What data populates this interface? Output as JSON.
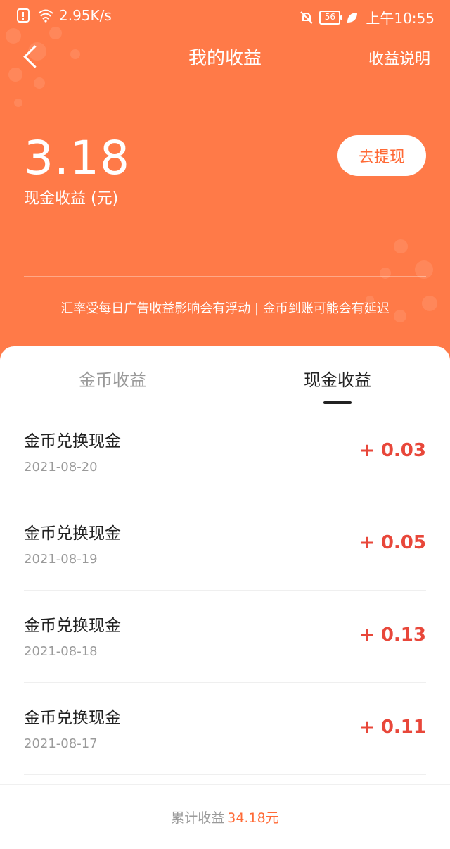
{
  "status_bar": {
    "speed": "2.95K/s",
    "battery": "56",
    "time": "上午10:55"
  },
  "nav": {
    "title": "我的收益",
    "right_link": "收益说明"
  },
  "summary": {
    "amount": "3.18",
    "label": "现金收益 (元)",
    "withdraw_button": "去提现",
    "notice": "汇率受每日广告收益影响会有浮动 | 金币到账可能会有延迟"
  },
  "tabs": [
    {
      "label": "金币收益"
    },
    {
      "label": "现金收益"
    }
  ],
  "records": [
    {
      "title": "金币兑换现金",
      "date": "2021-08-20",
      "amount": "+ 0.03"
    },
    {
      "title": "金币兑换现金",
      "date": "2021-08-19",
      "amount": "+ 0.05"
    },
    {
      "title": "金币兑换现金",
      "date": "2021-08-18",
      "amount": "+ 0.13"
    },
    {
      "title": "金币兑换现金",
      "date": "2021-08-17",
      "amount": "+ 0.11"
    }
  ],
  "footer": {
    "label": "累计收益",
    "value": "34.18元"
  },
  "colors": {
    "header_bg": "#ff7a48",
    "accent": "#ff6a36",
    "amount_red": "#e8473a"
  }
}
